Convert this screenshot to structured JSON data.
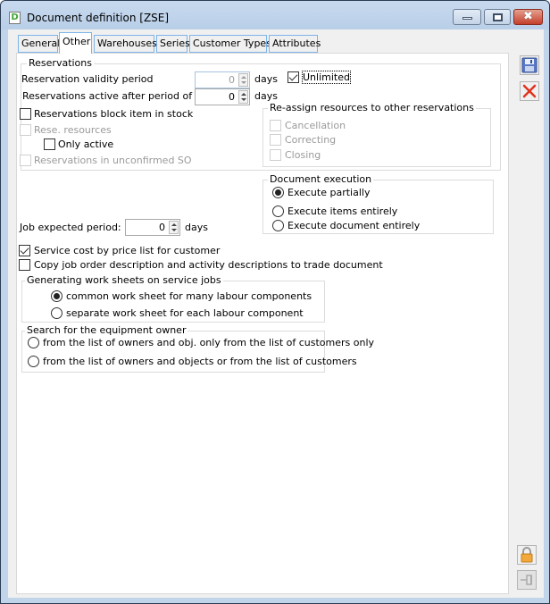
{
  "window": {
    "title": "Document definition [ZSE]",
    "icon": "document-d-icon",
    "controls": {
      "minimize": "minimize-icon",
      "maximize": "maximize-icon",
      "close": "✖"
    }
  },
  "tabs": [
    {
      "label": "General",
      "active": false
    },
    {
      "label": "Other",
      "active": true
    },
    {
      "label": "Warehouses",
      "active": false
    },
    {
      "label": "Series",
      "active": false
    },
    {
      "label": "Customer Types",
      "active": false
    },
    {
      "label": "Attributes",
      "active": false
    }
  ],
  "reservations": {
    "group_label": "Reservations",
    "validity_period_label": "Reservation validity period",
    "validity_period_value": "0",
    "validity_period_unit": "days",
    "unlimited_label": "Unlimited",
    "unlimited_checked": true,
    "active_after_label": "Reservations active after period of",
    "active_after_value": "0",
    "active_after_unit": "days",
    "block_item_label": "Reservations block item in stock",
    "rese_resources_label": "Rese. resources",
    "only_active_label": "Only active",
    "unconfirmed_so_label": "Reservations in unconfirmed SO",
    "reassign": {
      "group_label": "Re-assign resources to other reservations",
      "options": [
        "Cancellation",
        "Correcting",
        "Closing"
      ]
    }
  },
  "document_execution": {
    "group_label": "Document execution",
    "options": [
      {
        "label": "Execute partially",
        "selected": true
      },
      {
        "label": "Execute items entirely",
        "selected": false
      },
      {
        "label": "Execute document entirely",
        "selected": false
      }
    ]
  },
  "job": {
    "expected_period_label": "Job expected period:",
    "expected_period_value": "0",
    "expected_period_unit": "days"
  },
  "service_cost_label": "Service cost by price list for customer",
  "service_cost_checked": true,
  "copy_description_label": "Copy job order description and activity descriptions to trade document",
  "copy_description_checked": false,
  "work_sheets": {
    "group_label": "Generating work sheets on service jobs",
    "options": [
      {
        "label": "common work sheet for many labour components",
        "selected": true
      },
      {
        "label": "separate work sheet for each labour component",
        "selected": false
      }
    ]
  },
  "equipment_owner": {
    "group_label": "Search for the equipment owner",
    "options": [
      {
        "label": "from the list of owners and obj. only  from the list of customers only",
        "selected": false
      },
      {
        "label": "from the list of owners and objects or from the list of customers",
        "selected": false
      }
    ]
  },
  "side_buttons": {
    "save": "save-icon",
    "cancel": "cancel-icon",
    "lock": "lock-icon",
    "pin": "pin-icon"
  }
}
